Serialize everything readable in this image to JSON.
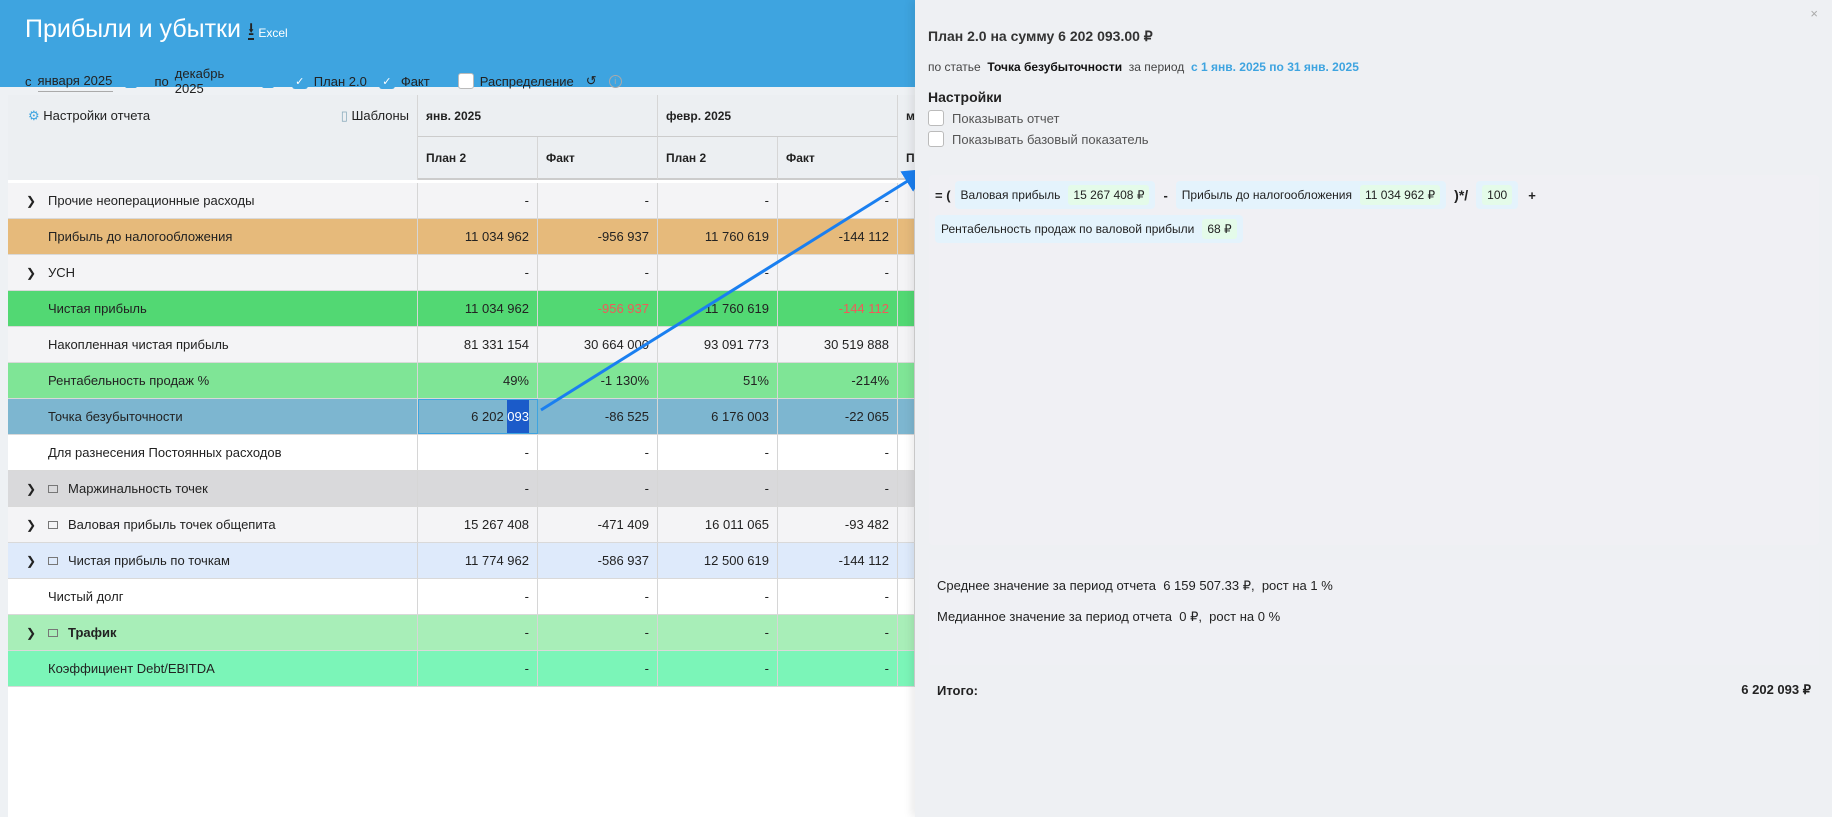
{
  "header": {
    "title": "Прибыли и убытки",
    "excel": "Excel"
  },
  "filters": {
    "from_label": "с",
    "from": "января 2025",
    "to_label": "по",
    "to": "декабрь 2025",
    "plan": "План 2.0",
    "fact": "Факт",
    "distribution": "Распределение"
  },
  "toolbar": {
    "settings": "Настройки отчета",
    "templates": "Шаблоны"
  },
  "months": [
    "янв. 2025",
    "февр. 2025",
    "м"
  ],
  "subcols": [
    "План 2",
    "Факт",
    "План 2",
    "Факт",
    "П"
  ],
  "rows": [
    {
      "label": "Прочие неоперационные расходы",
      "chev": true,
      "folder": false,
      "bg": "#f4f4f6",
      "v": [
        "-",
        "-",
        "-",
        "-"
      ]
    },
    {
      "label": "Прибыль до налогообложения",
      "chev": false,
      "folder": false,
      "bg": "#e6ba7b",
      "v": [
        "11 034 962",
        "-956 937",
        "11 760 619",
        "-144 112"
      ]
    },
    {
      "label": "УСН",
      "chev": true,
      "folder": false,
      "bg": "#f4f4f6",
      "v": [
        "-",
        "-",
        "-",
        "-"
      ]
    },
    {
      "label": "Чистая прибыль",
      "chev": false,
      "folder": false,
      "bg": "#52d873",
      "v": [
        "11 034 962",
        "-956 937",
        "11 760 619",
        "-144 112"
      ],
      "red": [
        1,
        3
      ]
    },
    {
      "label": "Накопленная чистая прибыль",
      "chev": false,
      "folder": false,
      "bg": "#f4f4f6",
      "v": [
        "81 331 154",
        "30 664 000",
        "93 091 773",
        "30 519 888"
      ]
    },
    {
      "label": "Рентабельность продаж %",
      "chev": false,
      "folder": false,
      "bg": "#7fe596",
      "v": [
        "49%",
        "-1 130%",
        "51%",
        "-214%"
      ]
    },
    {
      "label": "Точка безубыточности",
      "chev": false,
      "folder": false,
      "bg": "#7db6d0",
      "v": [
        "6 202 093",
        "-86 525",
        "6 176 003",
        "-22 065"
      ]
    },
    {
      "label": "Для разнесения Постоянных расходов",
      "chev": false,
      "folder": false,
      "bg": "#ffffff",
      "v": [
        "-",
        "-",
        "-",
        "-"
      ]
    },
    {
      "label": "Маржинальность точек",
      "chev": true,
      "folder": true,
      "bg": "#d9d9db",
      "v": [
        "-",
        "-",
        "-",
        "-"
      ]
    },
    {
      "label": "Валовая прибыль точек общепита",
      "chev": true,
      "folder": true,
      "bg": "#f4f4f6",
      "v": [
        "15 267 408",
        "-471 409",
        "16 011 065",
        "-93 482"
      ]
    },
    {
      "label": "Чистая прибыль по точкам",
      "chev": true,
      "folder": true,
      "bg": "#deeafb",
      "v": [
        "11 774 962",
        "-586 937",
        "12 500 619",
        "-144 112"
      ]
    },
    {
      "label": "Чистый долг",
      "chev": false,
      "folder": false,
      "bg": "#ffffff",
      "v": [
        "-",
        "-",
        "-",
        "-"
      ]
    },
    {
      "label": "Трафик",
      "chev": true,
      "folder": true,
      "bold": true,
      "bg": "#a8eeb8",
      "v": [
        "-",
        "-",
        "-",
        "-"
      ]
    },
    {
      "label": "Коэффициент Debt/EBITDA",
      "chev": false,
      "folder": false,
      "bg": "#7bf5b8",
      "v": [
        "-",
        "-",
        "-",
        "-"
      ]
    }
  ],
  "panel": {
    "close": "×",
    "title": "План 2.0 на сумму 6 202 093.00 ₽",
    "by_item": "по статье",
    "item": "Точка безубыточности",
    "for_period": "за период",
    "period": "с 1 янв. 2025 по 31 янв. 2025",
    "settings": "Настройки",
    "show_report": "Показывать отчет",
    "show_base": "Показывать базовый показатель",
    "formula": {
      "eq": "= (",
      "a_label": "Валовая прибыль",
      "a_val": "15 267 408 ₽",
      "minus": "-",
      "b_label": "Прибыль до налогообложения",
      "b_val": "11 034 962 ₽",
      "op": ")*/",
      "c_val": "100",
      "plus": "+",
      "d_label": "Рентабельность продаж по валовой прибыли",
      "d_val": "68 ₽"
    },
    "avg": "Среднее значение за период отчета  6 159 507.33 ₽,  рост на 1 %",
    "median": "Медианное значение за период отчета  0 ₽,  рост на 0 %",
    "total_label": "Итого:",
    "total": "6 202 093 ₽"
  }
}
